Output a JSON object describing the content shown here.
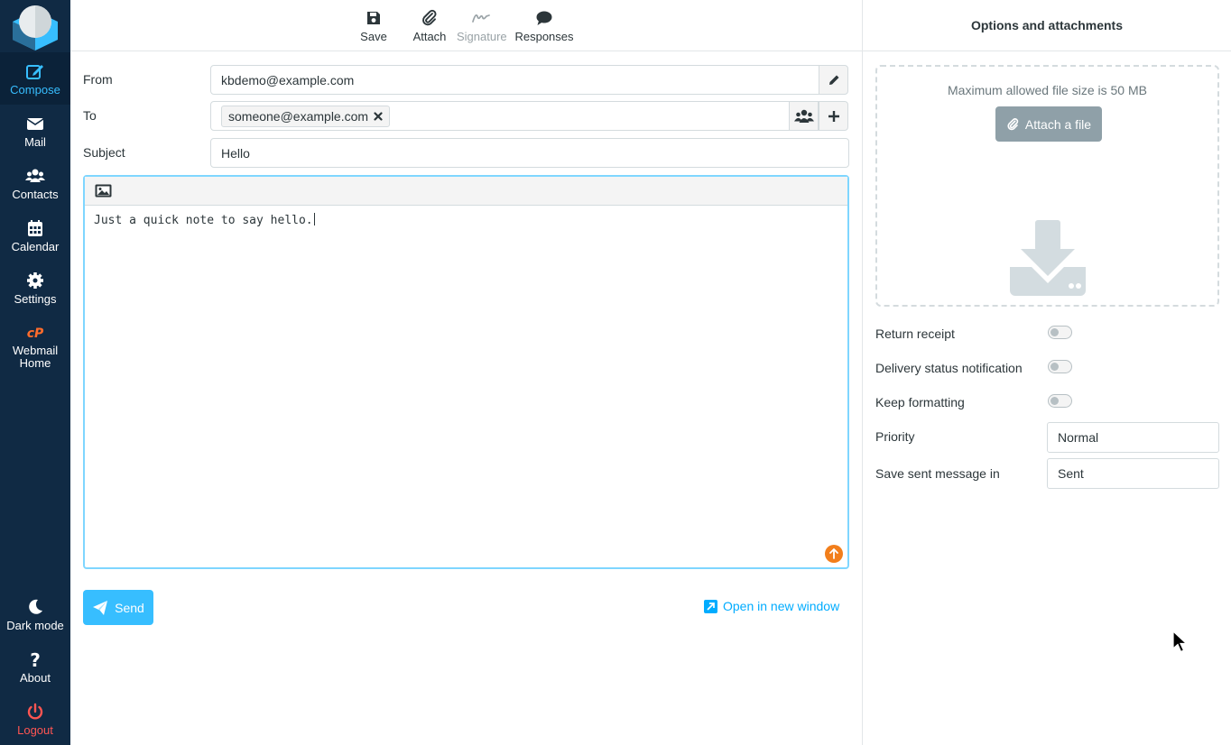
{
  "sidebar": {
    "items": [
      {
        "label": "Compose",
        "icon": "compose-icon"
      },
      {
        "label": "Mail",
        "icon": "envelope-icon"
      },
      {
        "label": "Contacts",
        "icon": "users-icon"
      },
      {
        "label": "Calendar",
        "icon": "calendar-icon"
      },
      {
        "label": "Settings",
        "icon": "gear-icon"
      },
      {
        "label": "Webmail",
        "label2": "Home",
        "icon": "cpanel-icon"
      }
    ],
    "bottom": [
      {
        "label": "Dark mode",
        "icon": "moon-icon"
      },
      {
        "label": "About",
        "icon": "question-icon"
      },
      {
        "label": "Logout",
        "icon": "power-icon"
      }
    ]
  },
  "toolbar": {
    "save": "Save",
    "attach": "Attach",
    "signature": "Signature",
    "responses": "Responses"
  },
  "compose": {
    "from_label": "From",
    "from_value": "kbdemo@example.com",
    "to_label": "To",
    "to_recipient": "someone@example.com",
    "subject_label": "Subject",
    "subject_value": "Hello",
    "body": "Just a quick note to say hello.",
    "send": "Send",
    "open_new_window": "Open in new window"
  },
  "options": {
    "title": "Options and attachments",
    "max_size": "Maximum allowed file size is 50 MB",
    "attach_file": "Attach a file",
    "return_receipt": "Return receipt",
    "delivery_status": "Delivery status notification",
    "keep_formatting": "Keep formatting",
    "priority_label": "Priority",
    "priority_value": "Normal",
    "save_sent_label": "Save sent message in",
    "save_sent_value": "Sent"
  },
  "colors": {
    "sidebar_bg": "#102a44",
    "accent": "#37beff",
    "logout": "#ff5552"
  }
}
